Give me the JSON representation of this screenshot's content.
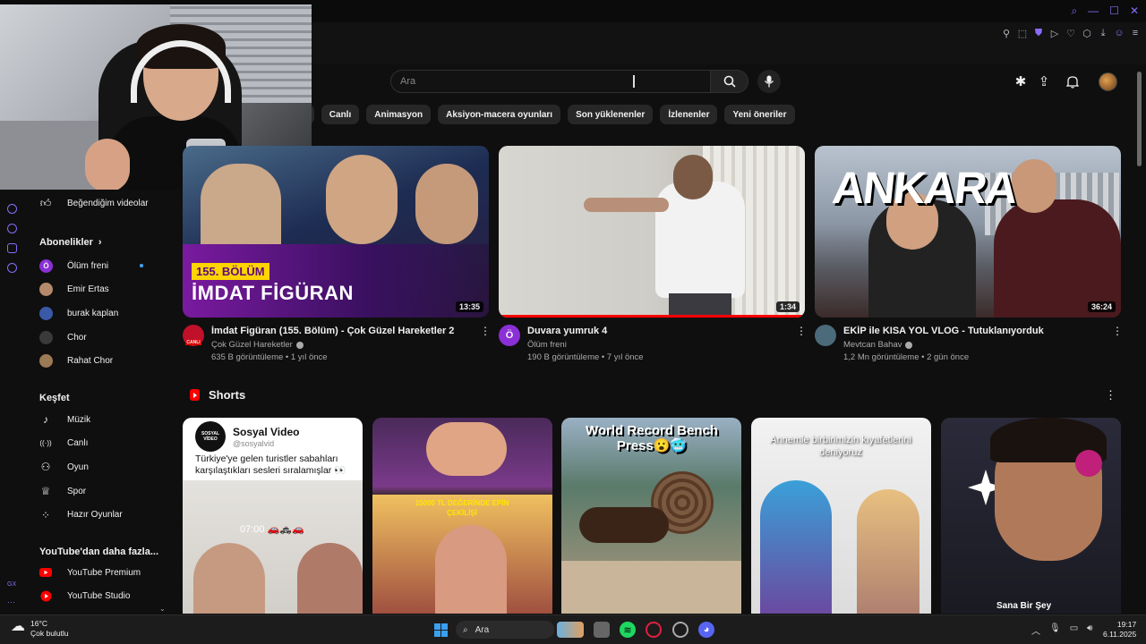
{
  "search": {
    "placeholder": "Ara"
  },
  "chips": [
    "Canlı",
    "Animasyon",
    "Aksiyon-macera oyunları",
    "Son yüklenenler",
    "İzlenenler",
    "Yeni öneriler"
  ],
  "sidebar": {
    "liked": "Beğendiğim videolar",
    "subs_heading": "Abonelikler",
    "subs": [
      {
        "name": "Ölüm freni",
        "color": "#8b2fd6",
        "initial": "Ö"
      },
      {
        "name": "Emir Ertas",
        "color": "#b58a6a"
      },
      {
        "name": "burak kaplan",
        "color": "#3a5aa8"
      },
      {
        "name": "Chor",
        "color": "#3a3a3a"
      },
      {
        "name": "Rahat Chor",
        "color": "#9c7a55"
      }
    ],
    "explore_heading": "Keşfet",
    "explore": [
      {
        "label": "Müzik",
        "icon": "music-note-icon",
        "glyph": "♪"
      },
      {
        "label": "Canlı",
        "icon": "live-icon",
        "glyph": "((·))"
      },
      {
        "label": "Oyun",
        "icon": "gamepad-icon",
        "glyph": "⚇"
      },
      {
        "label": "Spor",
        "icon": "trophy-icon",
        "glyph": "♕"
      },
      {
        "label": "Hazır Oyunlar",
        "icon": "playables-icon",
        "glyph": "⁘"
      }
    ],
    "more_heading": "YouTube'dan daha fazla...",
    "more": [
      {
        "label": "YouTube Premium",
        "icon": "youtube-premium-icon"
      },
      {
        "label": "YouTube Studio",
        "icon": "youtube-studio-icon"
      }
    ]
  },
  "videos": [
    {
      "title": "İmdat Figüran (155. Bölüm) - Çok Güzel Hareketler 2",
      "channel": "Çok Güzel Hareketler",
      "stats": "635 B görüntüleme • 1 yıl önce",
      "duration": "13:35",
      "verified": true,
      "overlay_badge": "155. BÖLÜM",
      "overlay_title": "İMDAT FİGÜRAN",
      "avatar_badge": "CANLI",
      "avatar_color": "#c0102a",
      "watched": 0
    },
    {
      "title": "Duvara yumruk 4",
      "channel": "Ölüm freni",
      "stats": "190 B görüntüleme • 7 yıl önce",
      "duration": "1:34",
      "verified": false,
      "avatar_initial": "Ö",
      "avatar_color": "#8b2fd6",
      "watched": 1.0
    },
    {
      "title": "EKİP ile KISA YOL VLOG - Tutuklanıyorduk",
      "channel": "Mevtcan Bahav",
      "stats": "1,2 Mn görüntüleme • 2 gün önce",
      "duration": "36:24",
      "verified": true,
      "overlay_title": "ANKARA",
      "avatar_color": "#4b6a7a",
      "watched": 0
    }
  ],
  "shorts_heading": "Shorts",
  "shorts": [
    {
      "channel_title": "Sosyal Video",
      "handle": "@sosyalvid",
      "caption": "Türkiye'ye gelen turistler sabahları karşılaştıkları sesleri sıralamışlar 👀",
      "time_label": "07:00 🚗🚓🚗",
      "logo_text": "SOSYAL VİDEO"
    },
    {
      "overlay": "15000 TL DEĞERİNDE EPİN ÇEKİLİŞİ"
    },
    {
      "overlay": "World Record Bench Press😮🥶"
    },
    {
      "overlay": "Annemle birbirimizin kıyafetlerini deniyoruz"
    },
    {
      "overlay": "Sana Bir Şey"
    }
  ],
  "taskbar": {
    "search": "Ara",
    "weather_temp": "16°C",
    "weather_desc": "Çok bulutlu",
    "time": "19:17",
    "date": "6.11.2025"
  },
  "rail_label": "GX",
  "colors": {
    "accent": "#8b6cf7",
    "yt_red": "#ff0000"
  }
}
